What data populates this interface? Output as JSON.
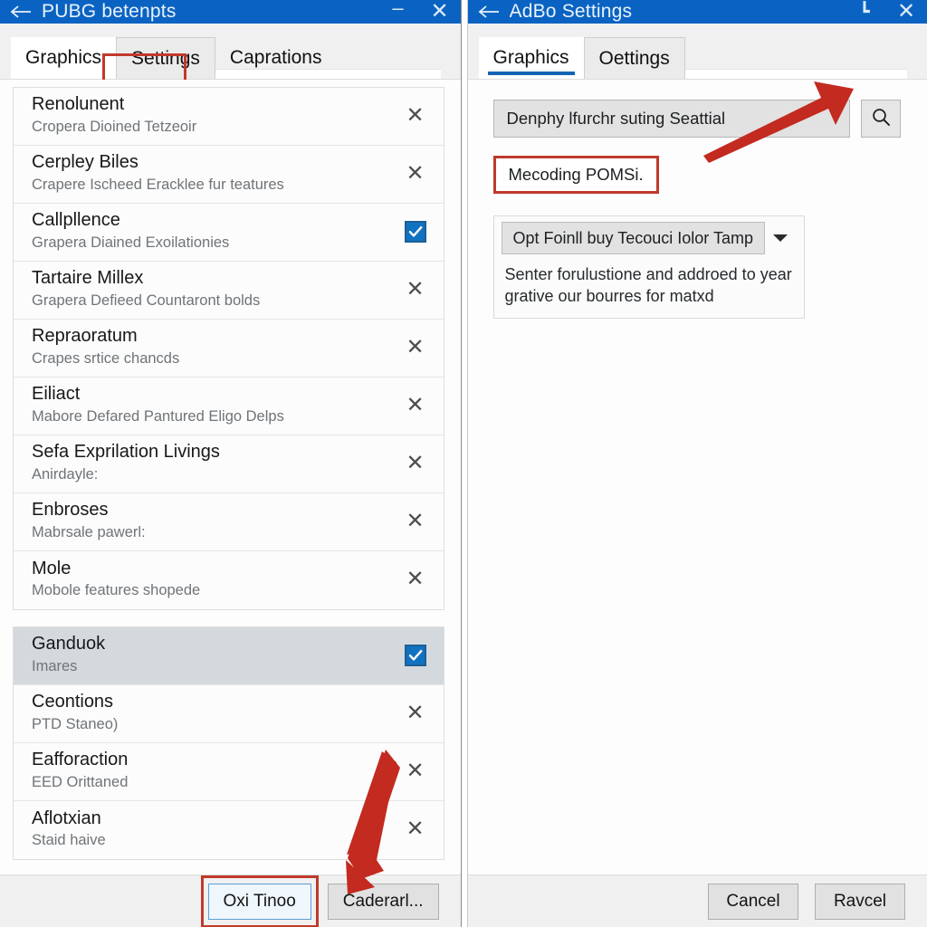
{
  "left_window": {
    "titlebar": {
      "back_icon": "back-arrow-icon",
      "title": "PUBG betenpts",
      "minimize_glyph": "–",
      "close_glyph": "✕"
    },
    "tabs": [
      {
        "label": "Graphics",
        "state": "active"
      },
      {
        "label": "Settings",
        "state": "raised-highlighted"
      },
      {
        "label": "Caprations",
        "state": "normal"
      }
    ],
    "list_group_1": [
      {
        "title": "Renolunent",
        "subtitle": "Cropera Dioined Tetzeoir",
        "action": "close",
        "selected": false
      },
      {
        "title": "Cerpley Biles",
        "subtitle": "Crapere Ischeed Eracklee fur teatures",
        "action": "close",
        "selected": false
      },
      {
        "title": "Callpllence",
        "subtitle": "Grapera Diained Exoilationies",
        "action": "checkbox",
        "selected": false
      },
      {
        "title": "Tartaire Millex",
        "subtitle": "Grapera Defieed Countaront bolds",
        "action": "close",
        "selected": false
      },
      {
        "title": "Repraoratum",
        "subtitle": "Crapes srtice chancds",
        "action": "close",
        "selected": false
      },
      {
        "title": "Eiliact",
        "subtitle": "Mabore Defared Pantured Eligo Delps",
        "action": "close",
        "selected": false
      },
      {
        "title": "Sefa Exprilation Livings",
        "subtitle": "Anirdayle:",
        "action": "close",
        "selected": false
      },
      {
        "title": "Enbroses",
        "subtitle": "Mabrsale pawerl:",
        "action": "close",
        "selected": false
      },
      {
        "title": "Mole",
        "subtitle": "Mobole features shopede",
        "action": "close",
        "selected": false
      }
    ],
    "list_group_2": [
      {
        "title": "Ganduok",
        "subtitle": "Imares",
        "action": "checkbox",
        "selected": true
      },
      {
        "title": "Ceontions",
        "subtitle": "PTD Staneo)",
        "action": "close",
        "selected": false
      },
      {
        "title": "Eafforaction",
        "subtitle": "EED Orittaned",
        "action": "close",
        "selected": false
      },
      {
        "title": "Aflotxian",
        "subtitle": "Staid haive",
        "action": "close",
        "selected": false
      }
    ],
    "footer": {
      "primary_button": "Oxi Tinoo",
      "secondary_button": "Caderarl..."
    }
  },
  "right_window": {
    "titlebar": {
      "back_icon": "back-arrow-icon",
      "title": "AdBo Settings",
      "maximize_glyph": "┗",
      "close_glyph": "✕"
    },
    "tabs": [
      {
        "label": "Graphics",
        "state": "active-underlined"
      },
      {
        "label": "Oettings",
        "state": "raised"
      }
    ],
    "search": {
      "value": "Denphy lfurchr suting Seattial",
      "placeholder": "Denphy lfurchr suting Seattial",
      "button_icon": "search-icon"
    },
    "result_chip": "Mecoding POMSi.",
    "dropdown": {
      "value": "Opt Foinll buy Tecouci Iolor Tamp",
      "caret_icon": "chevron-down-icon",
      "description": "Senter forulustione and addroed to year grative our bourres for matxd"
    },
    "footer": {
      "cancel_button": "Cancel",
      "confirm_button": "Ravcel"
    }
  },
  "annotations": {
    "accent_blue": "#0a63c2",
    "highlight_red": "#c0392b",
    "arrow_red": "#c32a20",
    "checkbox_blue": "#1172c0",
    "selected_row_grey": "#d4d9de"
  }
}
